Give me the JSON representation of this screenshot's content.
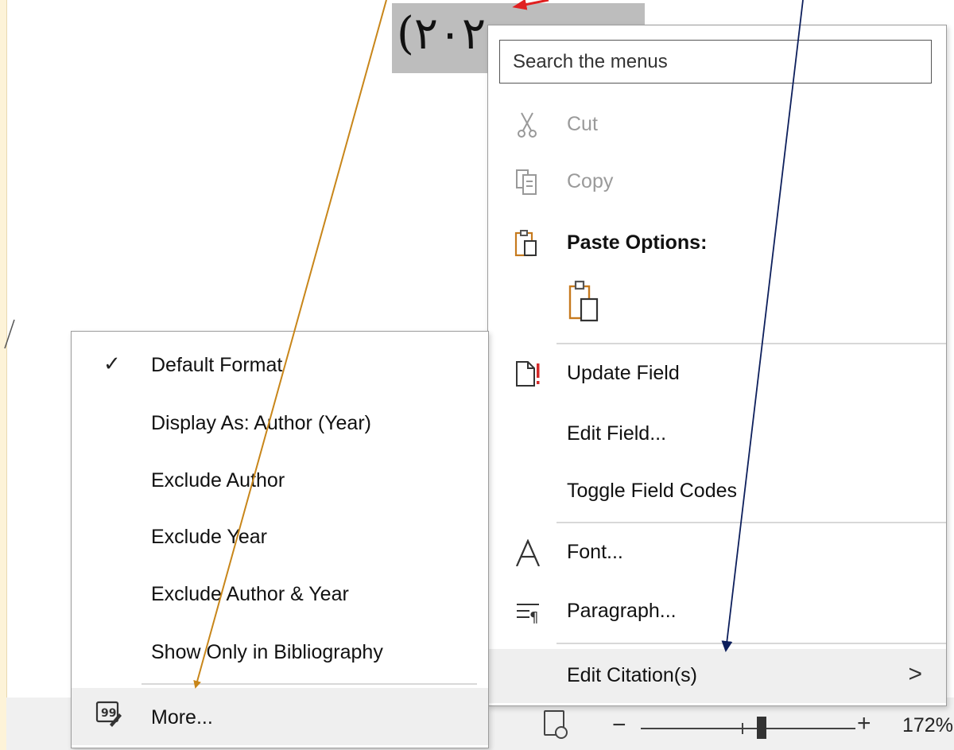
{
  "document": {
    "selected_text": "(٢٠٢"
  },
  "context_menu": {
    "search_placeholder": "Search the menus",
    "items": [
      {
        "label": "Cut",
        "icon": "scissors-icon",
        "enabled": false
      },
      {
        "label": "Copy",
        "icon": "copy-icon",
        "enabled": false
      },
      {
        "label": "Paste Options:",
        "icon": "paste-icon",
        "bold": true
      },
      {
        "label": "Update Field",
        "icon": "update-field-icon"
      },
      {
        "label": "Edit Field..."
      },
      {
        "label": "Toggle Field Codes"
      },
      {
        "label": "Font...",
        "icon": "font-icon"
      },
      {
        "label": "Paragraph...",
        "icon": "paragraph-icon"
      },
      {
        "label": "Edit Citation(s)",
        "submenu": true,
        "arrow": ">"
      }
    ]
  },
  "submenu": {
    "items": [
      {
        "label": "Default Format",
        "checked": true,
        "check": "✓"
      },
      {
        "label": "Display As: Author (Year)"
      },
      {
        "label": "Exclude Author"
      },
      {
        "label": "Exclude Year"
      },
      {
        "label": "Exclude Author & Year"
      },
      {
        "label": "Show Only in Bibliography"
      },
      {
        "label": "More...",
        "icon": "edit-citation-icon"
      }
    ]
  },
  "status_bar": {
    "zoom_minus": "−",
    "zoom_plus": "+",
    "zoom_level": "172%"
  },
  "colors": {
    "arrow_orange": "#c8861a",
    "arrow_navy": "#0d1f5c",
    "arrow_red": "#e02020",
    "icon_orange": "#c67a1e",
    "icon_red": "#d42a2a"
  }
}
